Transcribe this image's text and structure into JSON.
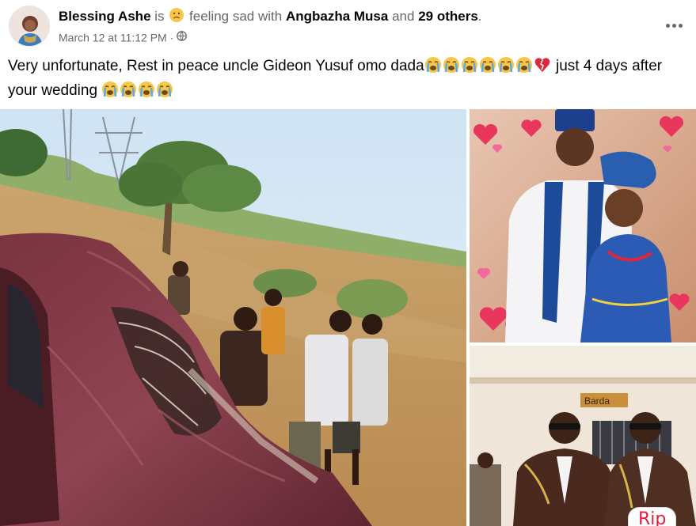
{
  "post": {
    "author_name": "Blessing Ashe",
    "is_text": "is",
    "feeling_text": "feeling sad with",
    "tagged_name": "Angbazha Musa",
    "and_text": "and",
    "others_text": "29 others",
    "period": ".",
    "timestamp": "March 12 at 11:12 PM",
    "separator": "·",
    "privacy_icon": "globe-icon",
    "more_icon": "more-options-icon"
  },
  "message": {
    "text_part1": "Very unfortunate, Rest in peace uncle Gideon Yusuf omo dada",
    "emoji_group1": [
      "crying-face",
      "crying-face",
      "crying-face",
      "crying-face",
      "crying-face",
      "crying-face"
    ],
    "broken_heart": "broken-heart",
    "text_part2": " just 4 days after your wedding ",
    "emoji_group2": [
      "crying-face",
      "crying-face",
      "crying-face",
      "crying-face"
    ]
  },
  "photos": {
    "main_alt": "crashed car with onlookers",
    "couple_alt": "couple in traditional attire",
    "officers_alt": "two men in uniforms",
    "rip_badge_text": "Rip",
    "wall_sign_text": "Barda"
  },
  "colors": {
    "accent": "#e41e3f",
    "text_muted": "#65676b",
    "sad_face": "#f7c548"
  }
}
